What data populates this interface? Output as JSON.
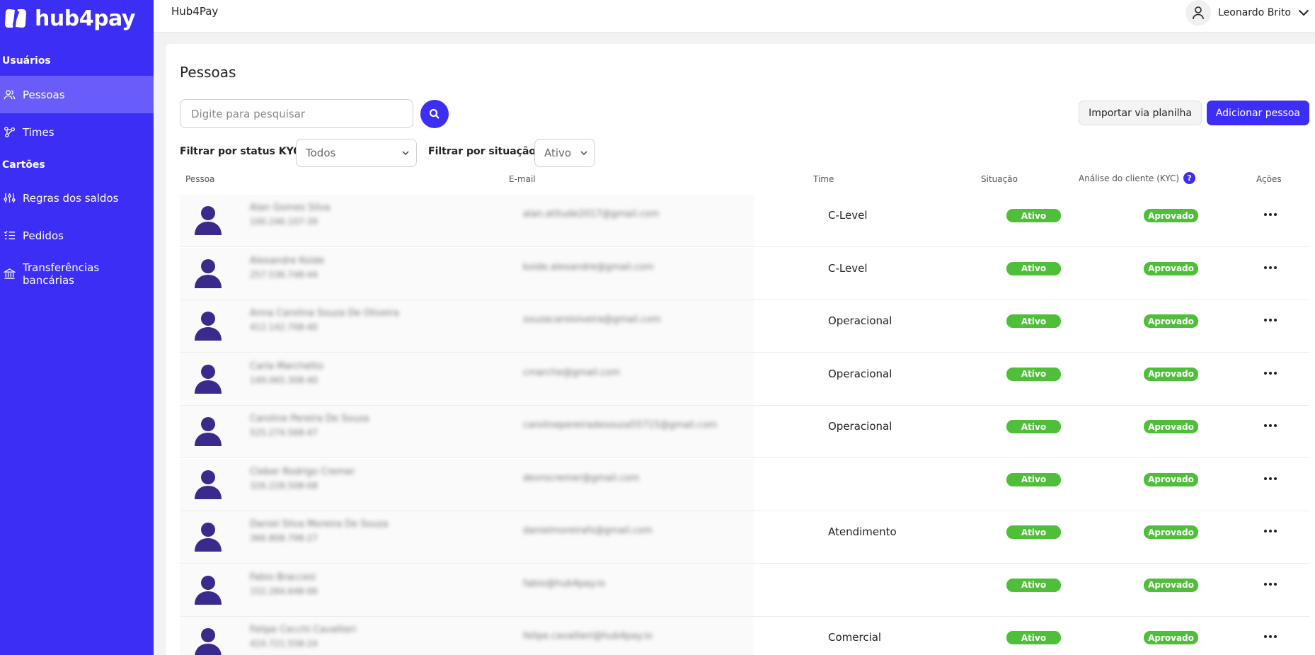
{
  "brand": {
    "logo_text": "hub4pay",
    "primary_color": "#3d2ef5",
    "success_color": "#4fbf3a"
  },
  "sidebar": {
    "sections": [
      {
        "label": "Usuários"
      },
      {
        "label": "Cartões"
      }
    ],
    "items": [
      {
        "label": "Pessoas",
        "icon": "users-icon",
        "active": true
      },
      {
        "label": "Times",
        "icon": "team-nodes-icon"
      },
      {
        "label": "Regras dos saldos",
        "icon": "sliders-icon"
      },
      {
        "label": "Pedidos",
        "icon": "list-check-icon"
      },
      {
        "label": "Transferências bancárias",
        "icon": "bank-icon"
      }
    ]
  },
  "topbar": {
    "title": "Hub4Pay",
    "user_name": "Leonardo Brito"
  },
  "main": {
    "title": "Pessoas",
    "search_placeholder": "Digite para pesquisar",
    "import_label": "Importar via planilha",
    "add_label": "Adicionar pessoa",
    "filters": {
      "kyc_label": "Filtrar por status KYC:",
      "kyc_value": "Todos",
      "situacao_label": "Filtrar por situação:",
      "situacao_value": "Ativo"
    },
    "columns": {
      "pessoa": "Pessoa",
      "email": "E-mail",
      "time": "Time",
      "situacao": "Situação",
      "kyc": "Análise do cliente (KYC)",
      "acoes": "Ações"
    },
    "help_glyph": "?",
    "rows": [
      {
        "name": "Alan Gomes Silva",
        "cpf": "100.246.107-39",
        "email": "alan.atitude2017@gmail.com",
        "team": "C-Level",
        "status": "Ativo",
        "kyc": "Aprovado"
      },
      {
        "name": "Alexandre Koide",
        "cpf": "257.536.748-44",
        "email": "koide.alexandre@gmail.com",
        "team": "C-Level",
        "status": "Ativo",
        "kyc": "Aprovado"
      },
      {
        "name": "Anna Carolina Souza De Oliveira",
        "cpf": "412.142.708-40",
        "email": "souzacaroloiveira@gmail.com",
        "team": "Operacional",
        "status": "Ativo",
        "kyc": "Aprovado"
      },
      {
        "name": "Carla Marchetto",
        "cpf": "149.065.308-40",
        "email": "cmarche@gmail.com",
        "team": "Operacional",
        "status": "Ativo",
        "kyc": "Aprovado"
      },
      {
        "name": "Caroline Pereira De Souza",
        "cpf": "525.274.568-47",
        "email": "carolinepereiradesouza55715@gmail.com",
        "team": "Operacional",
        "status": "Ativo",
        "kyc": "Aprovado"
      },
      {
        "name": "Cleber Rodrigo Cremer",
        "cpf": "326.228.508-08",
        "email": "devrocremer@gmail.com",
        "team": "",
        "status": "Ativo",
        "kyc": "Aprovado"
      },
      {
        "name": "Daniel Silva Moreira De Souza",
        "cpf": "366.808.798-27",
        "email": "danielmoreirafs@gmail.com",
        "team": "Atendimento",
        "status": "Ativo",
        "kyc": "Aprovado"
      },
      {
        "name": "Fabio Braccesi",
        "cpf": "152.284.648-06",
        "email": "fabio@hub4pay.io",
        "team": "",
        "status": "Ativo",
        "kyc": "Aprovado"
      },
      {
        "name": "Felipe Cecchi Cavallieri",
        "cpf": "424.721.558-24",
        "email": "felipe.cavallieri@hub4pay.io",
        "team": "Comercial",
        "status": "Ativo",
        "kyc": "Aprovado"
      }
    ]
  }
}
